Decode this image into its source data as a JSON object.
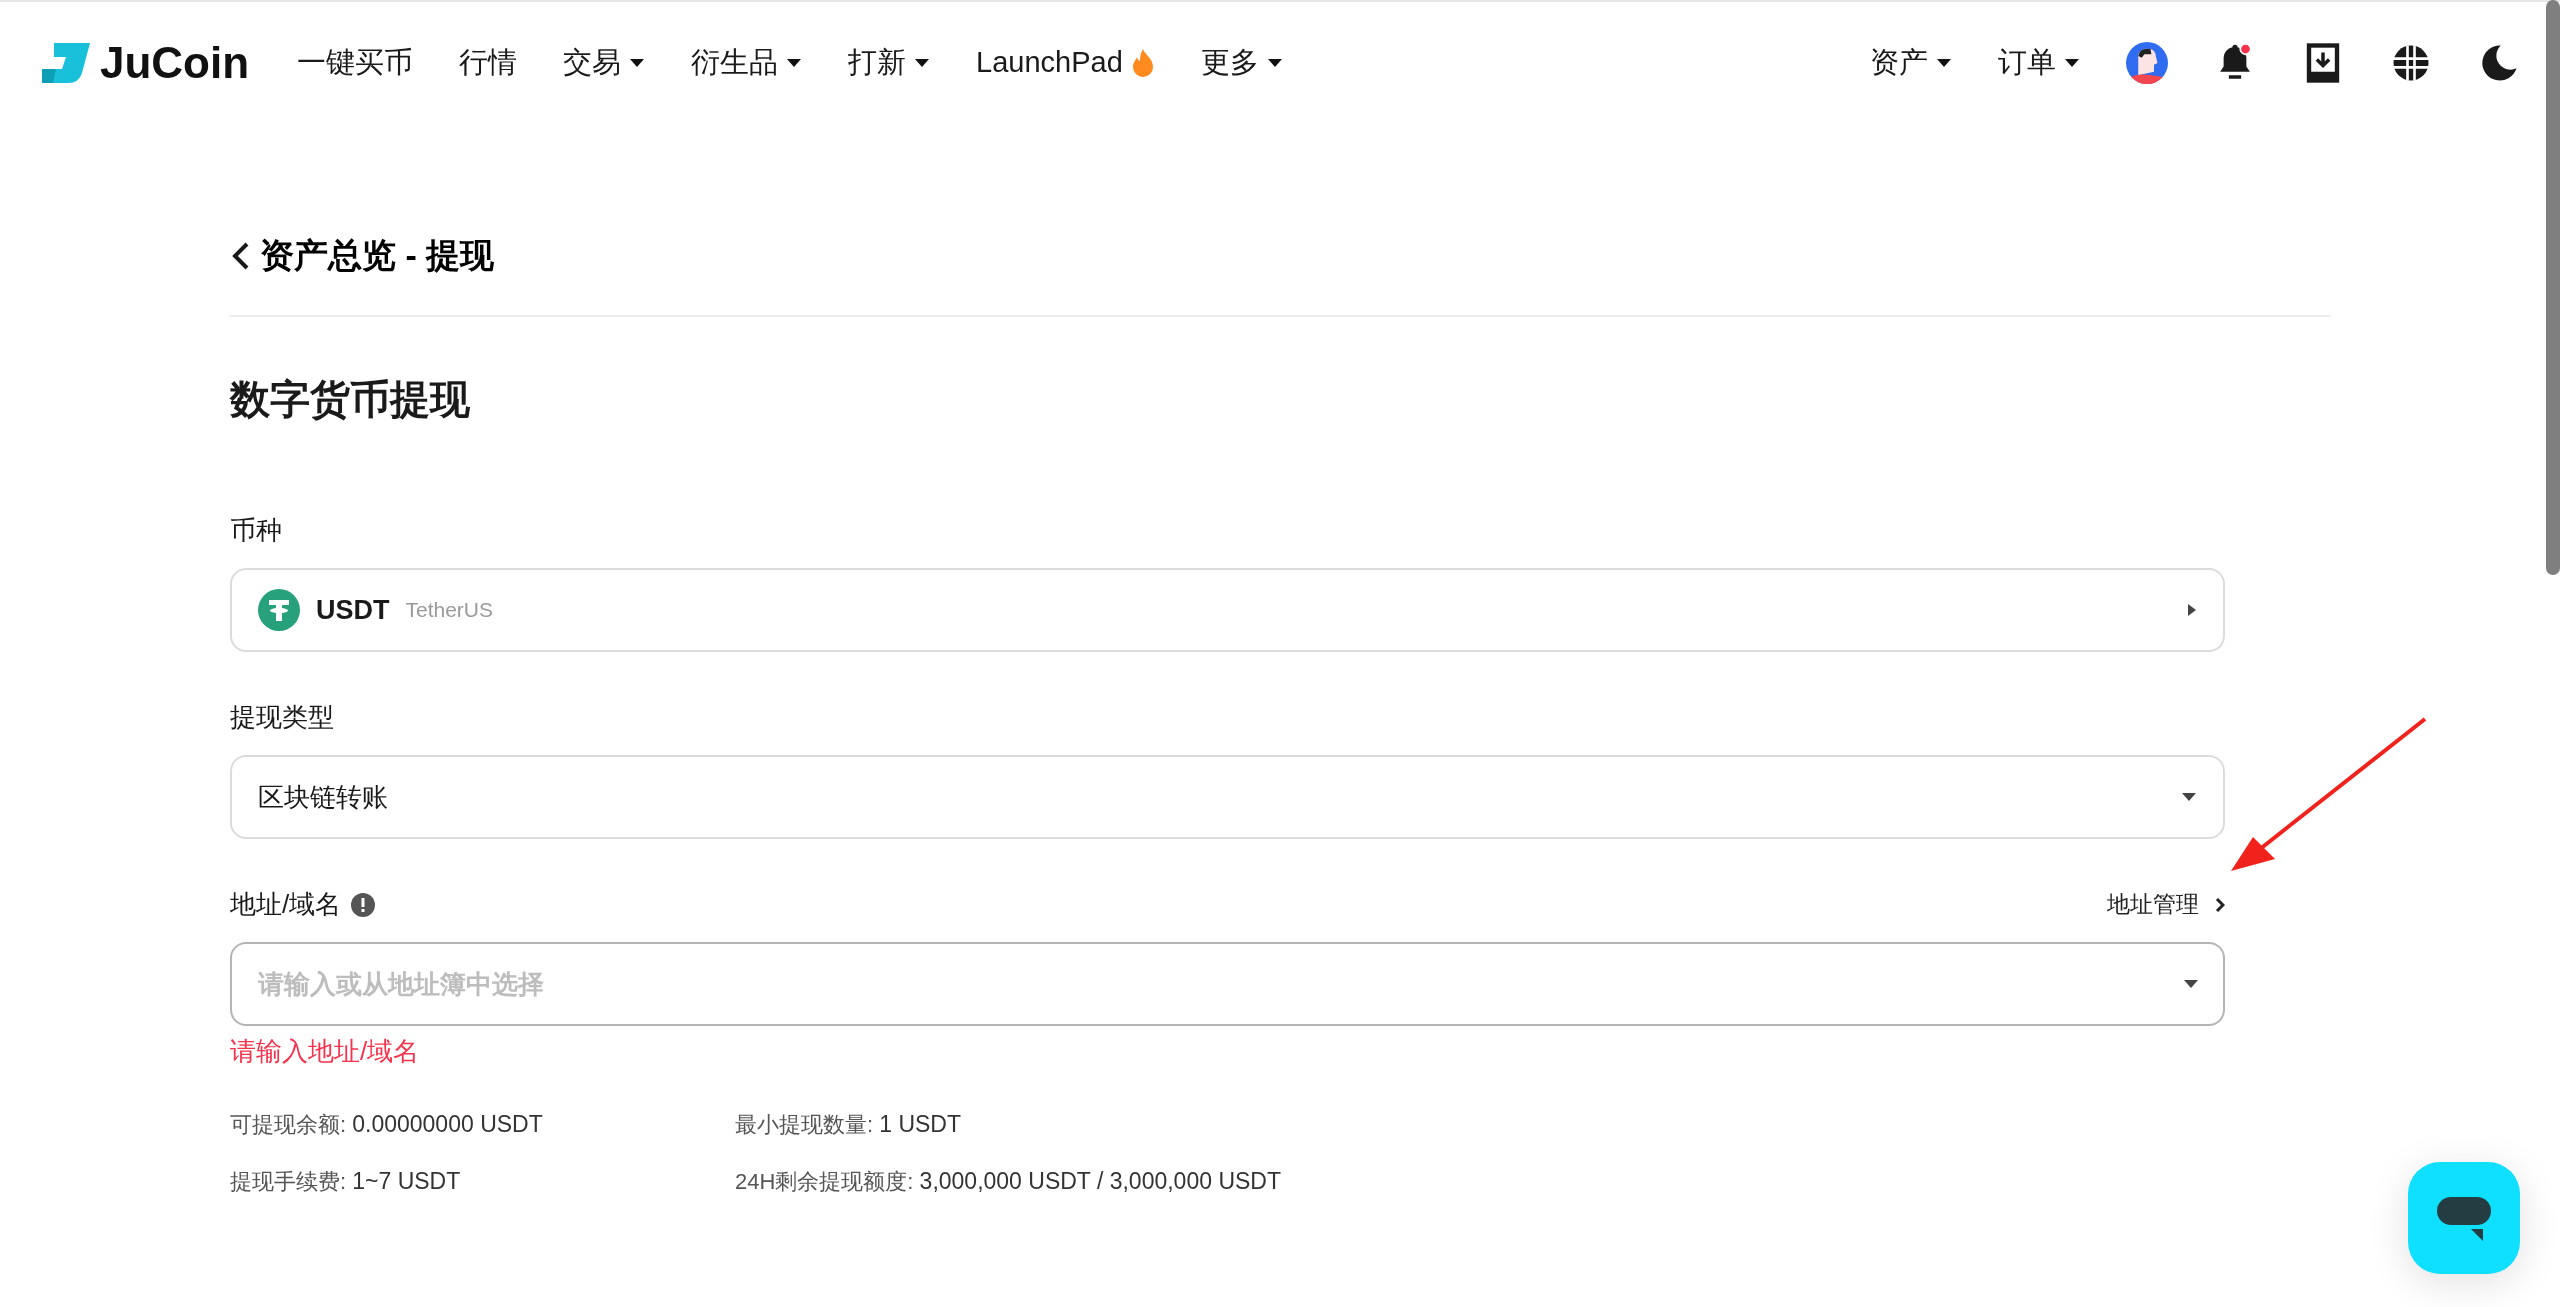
{
  "header": {
    "logo": "JuCoin",
    "nav": [
      {
        "label": "一键买币",
        "kind": "link"
      },
      {
        "label": "行情",
        "kind": "link"
      },
      {
        "label": "交易",
        "kind": "dropdown"
      },
      {
        "label": "衍生品",
        "kind": "dropdown"
      },
      {
        "label": "打新",
        "kind": "dropdown"
      },
      {
        "label": "LaunchPad",
        "kind": "hot"
      },
      {
        "label": "更多",
        "kind": "dropdown"
      }
    ],
    "right_menus": [
      {
        "label": "资产",
        "kind": "dropdown"
      },
      {
        "label": "订单",
        "kind": "dropdown"
      }
    ],
    "notification_dot": true
  },
  "back_title": "资产总览 - 提现",
  "title": "数字货币提现",
  "fields": [
    {
      "kind": "coin",
      "label": "币种",
      "value": "USDT",
      "subtitle": "TetherUS"
    },
    {
      "kind": "select",
      "label": "提现类型",
      "value": "区块链转账"
    },
    {
      "kind": "address",
      "label": "地址/域名",
      "link": "地址管理",
      "placeholder": "请输入或从地址簿中选择",
      "error": "请输入地址/域名"
    }
  ],
  "info": [
    {
      "label": "可提现余额:",
      "value": "0.00000000 USDT"
    },
    {
      "label": "最小提现数量:",
      "value": "1 USDT"
    },
    {
      "label": "提现手续费:",
      "value": "1~7 USDT"
    },
    {
      "label": "24H剩余提现额度:",
      "value": "3,000,000 USDT / 3,000,000 USDT"
    }
  ]
}
